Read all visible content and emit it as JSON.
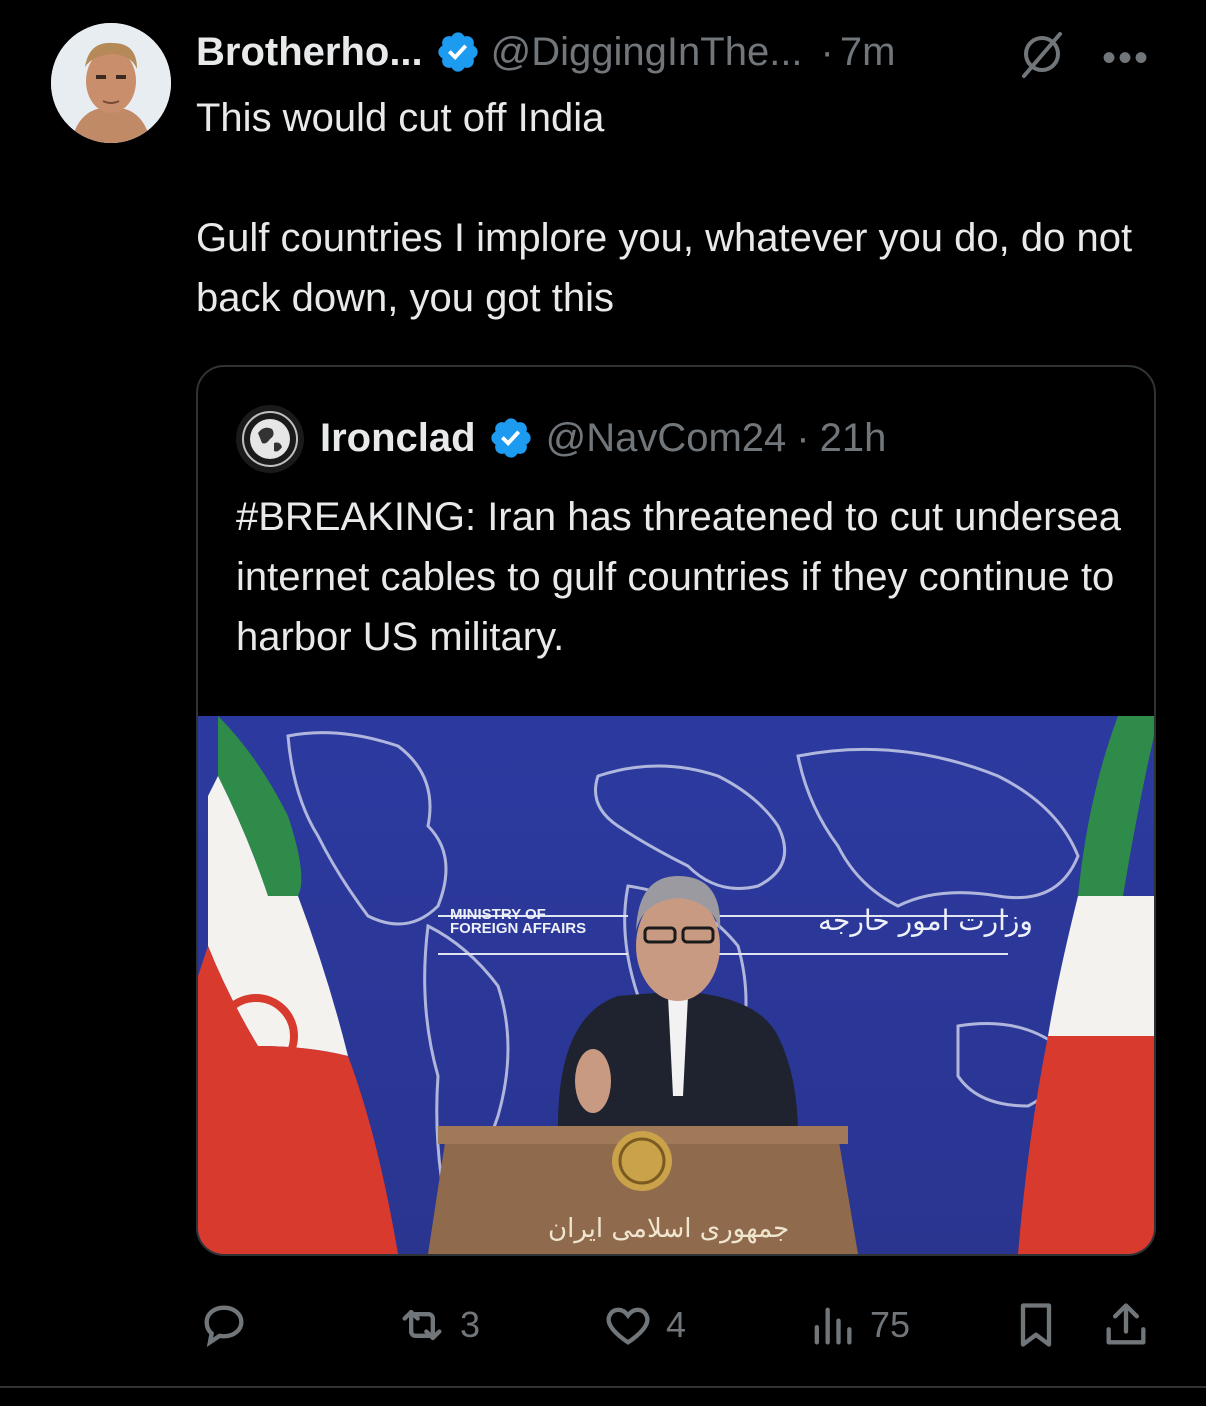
{
  "tweet": {
    "author_name": "Brotherho...",
    "author_handle": "@DiggingInThe...",
    "separator": "·",
    "time": "7m",
    "more_label": "•••",
    "paragraph1": "This would cut off India",
    "paragraph2": "Gulf countries I implore you, whatever you do, do not back down, you got this"
  },
  "quoted": {
    "author_name": "Ironclad",
    "author_handle": "@NavCom24",
    "separator": "·",
    "time": "21h",
    "text": "#BREAKING: Iran has threatened to cut undersea internet cables to gulf countries if they continue to harbor US military.",
    "image": {
      "sign_en_line1": "MINISTRY OF",
      "sign_en_line2": "FOREIGN AFFAIRS",
      "sign_fa": "وزارت امور خارجه",
      "podium_text": "جمهوری اسلامی ایران"
    }
  },
  "actions": {
    "reply_count": "",
    "repost_count": "3",
    "like_count": "4",
    "views_count": "75"
  },
  "colors": {
    "background": "#000000",
    "text": "#e7e9ea",
    "muted": "#71767b",
    "verified": "#1d9bf0",
    "border": "#2f3336"
  }
}
